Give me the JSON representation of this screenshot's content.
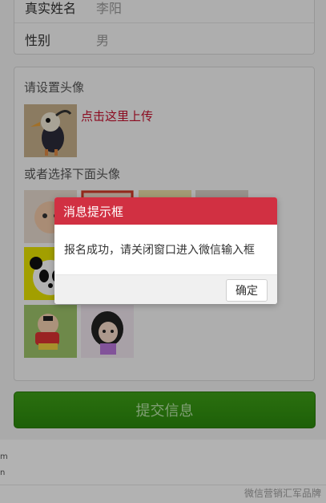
{
  "form": {
    "name_label": "真实姓名",
    "name_value": "李阳",
    "gender_label": "性别",
    "gender_value": "男"
  },
  "avatar_section": {
    "title": "请设置头像",
    "upload_link": "点击这里上传",
    "choose_title": "或者选择下面头像"
  },
  "submit_button": "提交信息",
  "dialog": {
    "title": "消息提示框",
    "message": "报名成功，请关闭窗口进入微信输入框",
    "confirm": "确定"
  },
  "footer": {
    "hint_line1": "m",
    "hint_line2": "n",
    "watermark": "微信营销汇军品牌"
  },
  "colors": {
    "dialog_header": "#d13042",
    "submit_button": "#35951a",
    "link": "#c8102e"
  }
}
